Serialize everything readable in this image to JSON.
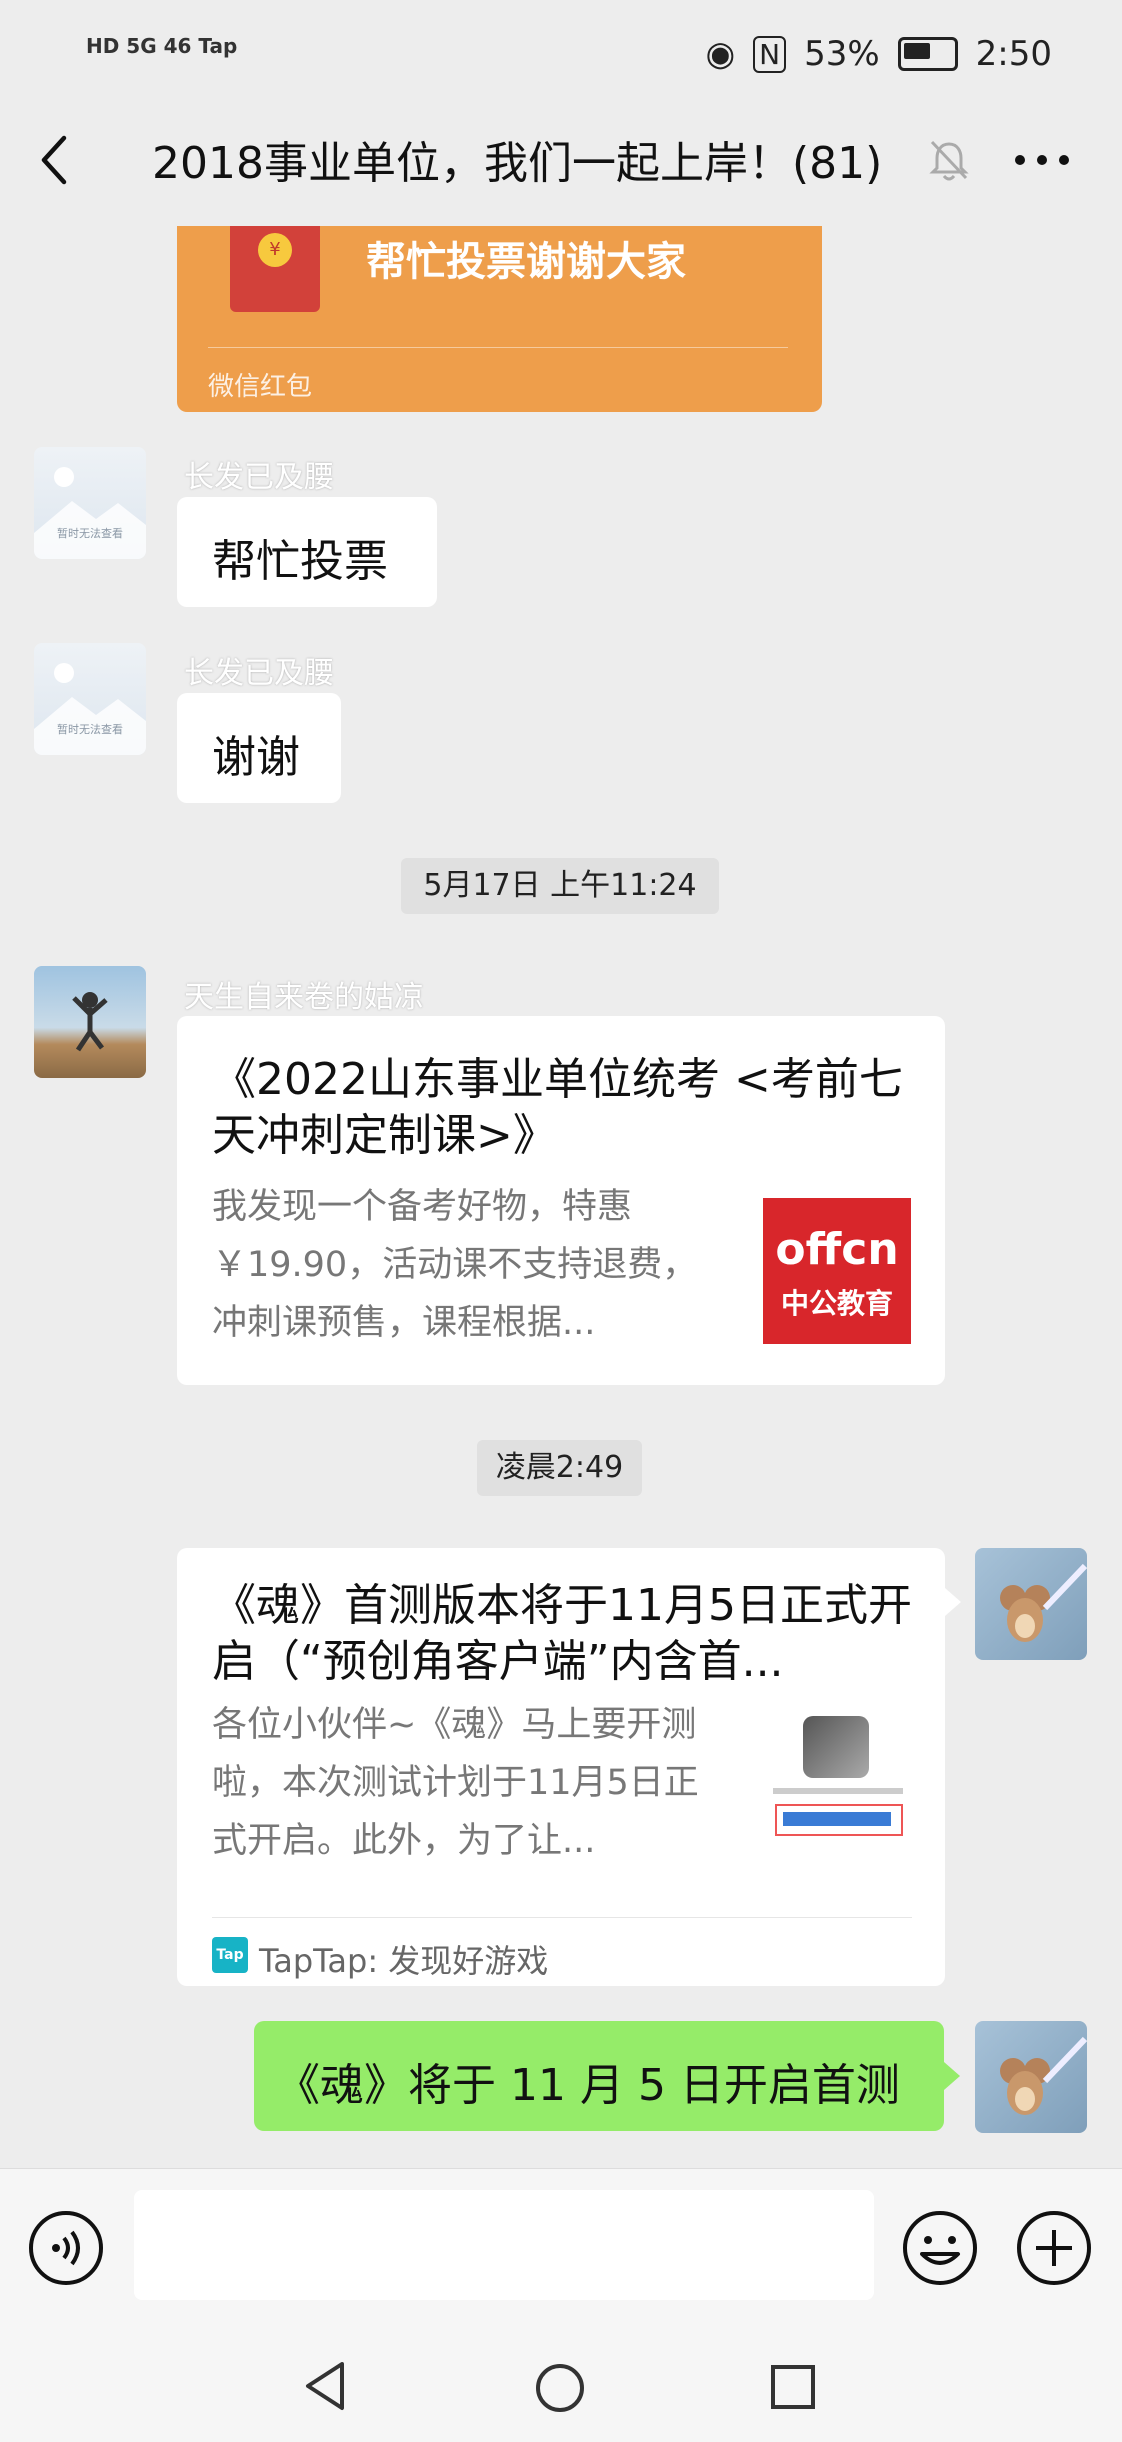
{
  "status_bar": {
    "left_text": "HD 5G 46 Tap",
    "battery_percent": "53%",
    "time": "2:50"
  },
  "header": {
    "title": "2018事业单位，我们一起上岸！(81)"
  },
  "red_packet": {
    "message": "帮忙投票谢谢大家",
    "label": "微信红包",
    "coin_symbol": "¥"
  },
  "messages": [
    {
      "sender": "长发已及腰",
      "text": "帮忙投票",
      "avatar_placeholder": "暂时无法查看"
    },
    {
      "sender": "长发已及腰",
      "text": "谢谢",
      "avatar_placeholder": "暂时无法查看"
    }
  ],
  "time_1": "5月17日 上午11:24",
  "card_1": {
    "sender": "天生自来卷的姑凉",
    "title": "《2022山东事业单位统考 <考前七天冲刺定制课>》",
    "desc": "我发现一个备考好物，特惠￥19.90，活动课不支持退费，冲刺课预售，课程根据...",
    "logo_top": "offcn",
    "logo_bottom": "中公教育"
  },
  "time_2": "凌晨2:49",
  "card_2": {
    "title": "《魂》首测版本将于11月5日正式开启（“预创角客户端”内含首...",
    "desc": "各位小伙伴~《魂》马上要开测啦，本次测试计划于11月5日正式开启。此外，为了让...",
    "source_icon": "Tap",
    "source": "TapTap: 发现好游戏"
  },
  "my_message": "《魂》将于 11 月 5 日开启首测",
  "colors": {
    "background": "#ededed",
    "red_packet": "#ee9e4b",
    "my_bubble": "#95ec69",
    "offcn_red": "#d8262b"
  }
}
